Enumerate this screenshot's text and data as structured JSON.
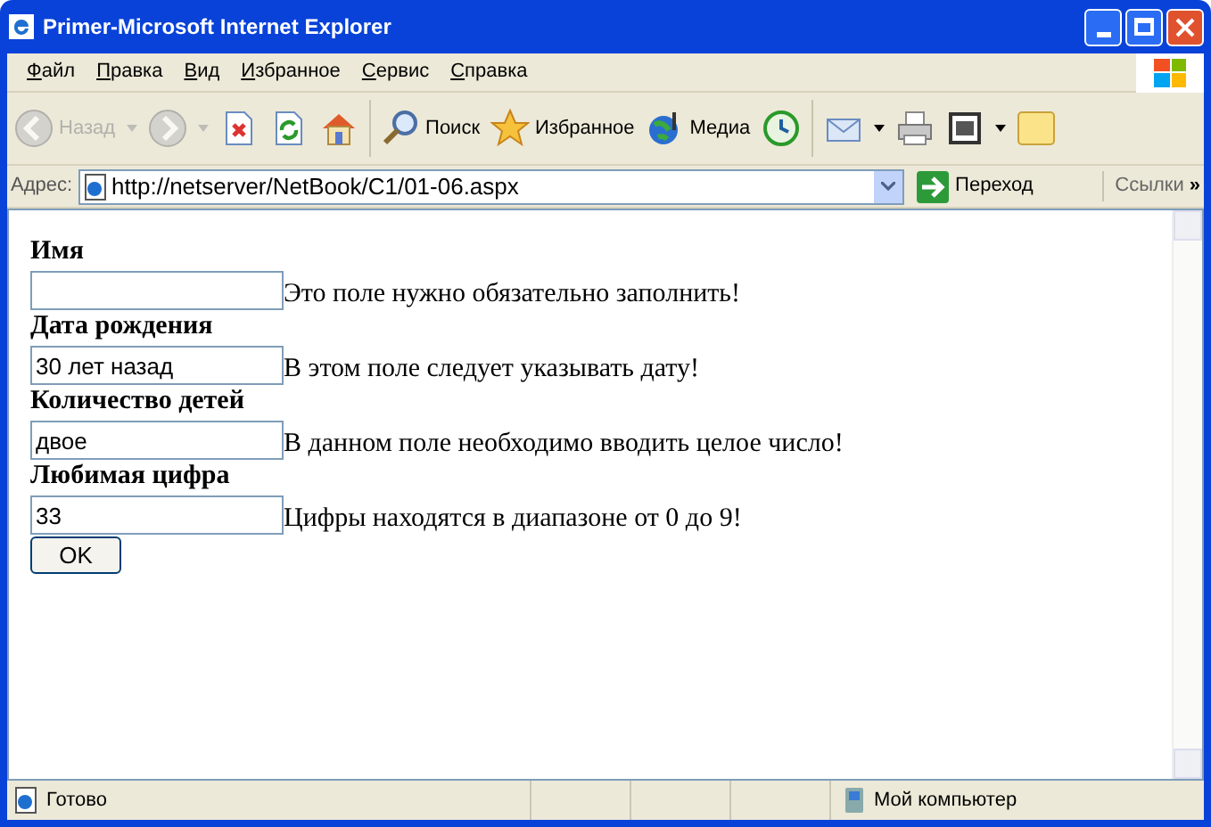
{
  "window": {
    "title": "Primer-Microsoft Internet Explorer"
  },
  "menu": [
    "Файл",
    "Правка",
    "Вид",
    "Избранное",
    "Сервис",
    "Справка"
  ],
  "toolbar": [
    {
      "kind": "back",
      "label": "Назад",
      "disabled": true,
      "dropdown": true
    },
    {
      "kind": "forward",
      "disabled": true,
      "dropdown": true
    },
    {
      "kind": "stop",
      "disabled": false,
      "dropdown": false
    },
    {
      "kind": "refresh",
      "disabled": false,
      "dropdown": false
    },
    {
      "kind": "home",
      "disabled": false,
      "dropdown": false
    },
    {
      "kind": "search",
      "label": "Поиск",
      "disabled": false,
      "dropdown": false
    },
    {
      "kind": "favorites",
      "label": "Избранное",
      "disabled": false,
      "dropdown": false
    },
    {
      "kind": "media",
      "label": "Медиа",
      "disabled": false,
      "dropdown": false
    },
    {
      "kind": "history",
      "disabled": false,
      "dropdown": false
    },
    {
      "kind": "mail",
      "disabled": false,
      "dropdown": true
    },
    {
      "kind": "print",
      "disabled": false,
      "dropdown": false
    },
    {
      "kind": "edit",
      "disabled": false,
      "dropdown": true
    },
    {
      "kind": "note",
      "disabled": false,
      "dropdown": false
    }
  ],
  "address": {
    "label": "Адрес:",
    "url": "http://netserver/NetBook/C1/01-06.aspx",
    "go": "Переход",
    "links": "Ссылки",
    "more": "»"
  },
  "form": {
    "fields": [
      {
        "label": "Имя",
        "message": "Это поле нужно обязательно заполнить!"
      },
      {
        "label": "Дата рождения",
        "value": "30 лет назад",
        "message": "В этом поле следует указывать дату!"
      },
      {
        "label": "Количество детей",
        "value": "двое",
        "message": "В данном поле необходимо вводить целое число!"
      },
      {
        "label": "Любимая цифра",
        "value": "33",
        "message": "Цифры находятся в диапазоне от 0 до 9!"
      }
    ],
    "submit": "OK"
  },
  "status_bar": {
    "text": "Готово",
    "zone": "Мой компьютер"
  }
}
